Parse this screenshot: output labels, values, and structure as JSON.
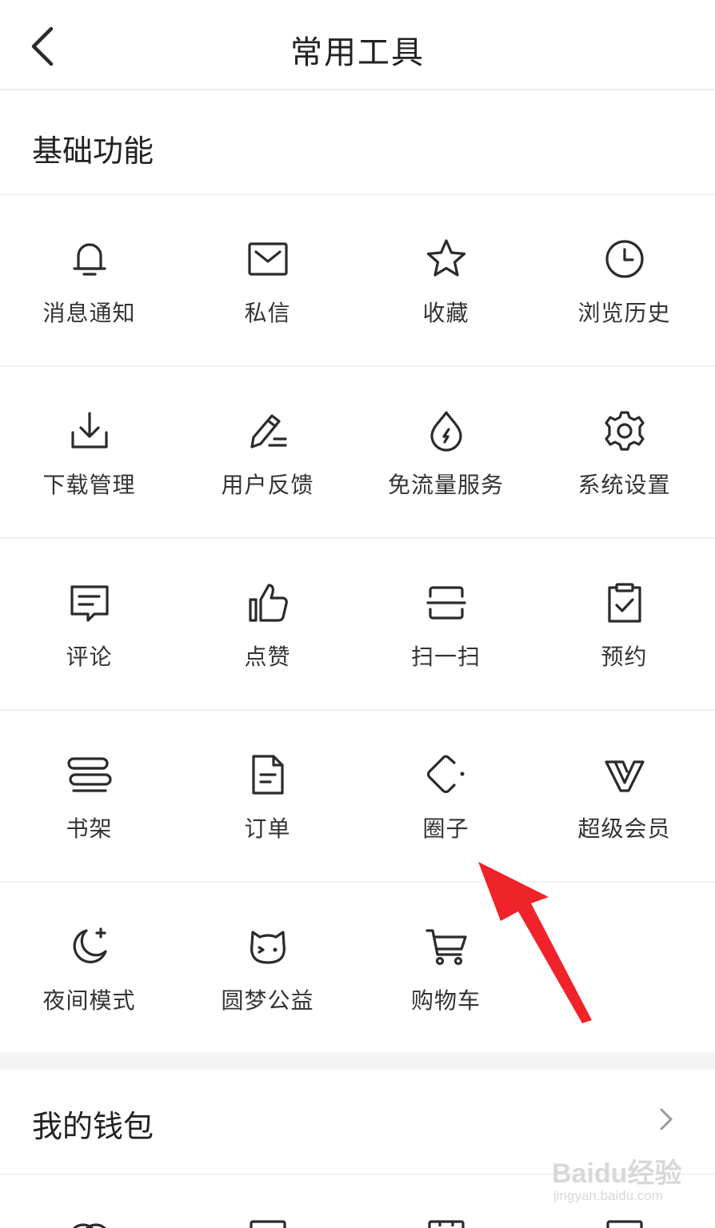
{
  "header": {
    "title": "常用工具"
  },
  "basic": {
    "title": "基础功能",
    "items": [
      {
        "label": "消息通知",
        "icon": "bell-icon"
      },
      {
        "label": "私信",
        "icon": "mail-icon"
      },
      {
        "label": "收藏",
        "icon": "star-icon"
      },
      {
        "label": "浏览历史",
        "icon": "clock-icon"
      },
      {
        "label": "下载管理",
        "icon": "download-icon"
      },
      {
        "label": "用户反馈",
        "icon": "pen-icon"
      },
      {
        "label": "免流量服务",
        "icon": "drop-icon"
      },
      {
        "label": "系统设置",
        "icon": "gear-icon"
      },
      {
        "label": "评论",
        "icon": "comment-icon"
      },
      {
        "label": "点赞",
        "icon": "thumbs-up-icon"
      },
      {
        "label": "扫一扫",
        "icon": "scan-icon"
      },
      {
        "label": "预约",
        "icon": "clipboard-check-icon"
      },
      {
        "label": "书架",
        "icon": "bookshelf-icon"
      },
      {
        "label": "订单",
        "icon": "document-icon"
      },
      {
        "label": "圈子",
        "icon": "circle-group-icon"
      },
      {
        "label": "超级会员",
        "icon": "vip-icon"
      },
      {
        "label": "夜间模式",
        "icon": "moon-icon"
      },
      {
        "label": "圆梦公益",
        "icon": "cat-face-icon"
      },
      {
        "label": "购物车",
        "icon": "cart-icon"
      }
    ]
  },
  "wallet": {
    "title": "我的钱包"
  },
  "watermark": {
    "main": "Baidu经验",
    "sub": "jingyan.baidu.com"
  },
  "colors": {
    "annotation_arrow": "#f0222a",
    "icon_stroke": "#2b2b2b"
  }
}
